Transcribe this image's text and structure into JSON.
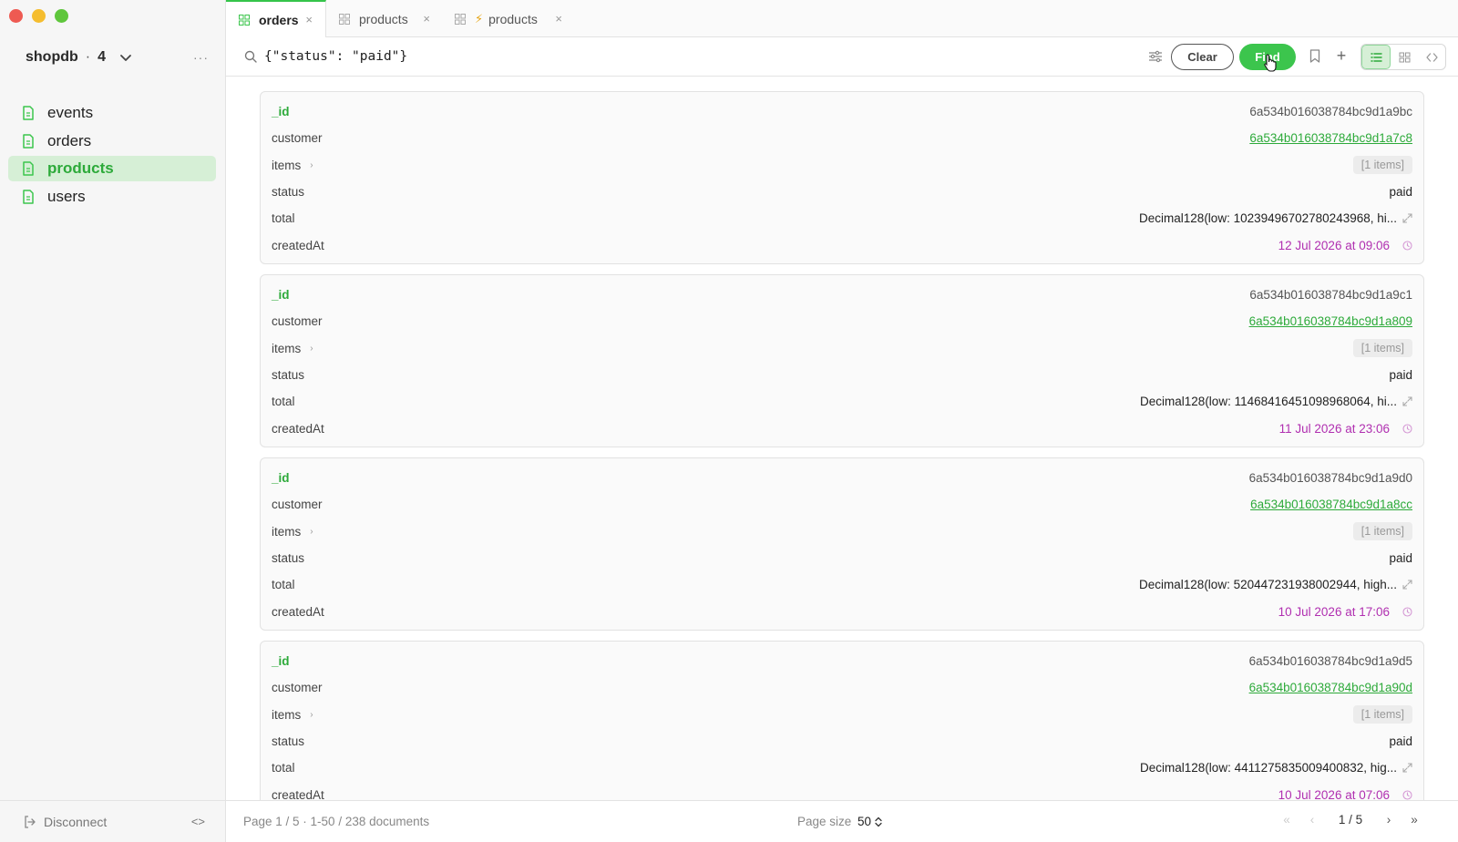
{
  "sidebar": {
    "db_name": "shopdb",
    "db_separator": "·",
    "db_count": "4",
    "more_label": "···",
    "collections": [
      {
        "label": "events",
        "active": false
      },
      {
        "label": "orders",
        "active": false
      },
      {
        "label": "products",
        "active": true
      },
      {
        "label": "users",
        "active": false
      }
    ],
    "disconnect_label": "Disconnect",
    "code_toggle": "<>"
  },
  "tabs": [
    {
      "label": "orders",
      "active": true,
      "bolt": false
    },
    {
      "label": "products",
      "active": false,
      "bolt": false
    },
    {
      "label": "products",
      "active": false,
      "bolt": true
    }
  ],
  "tab_close": "×",
  "query": {
    "value": "{\"status\": \"paid\"}",
    "clear_label": "Clear",
    "find_label": "Find",
    "plus_label": "+"
  },
  "documents": [
    {
      "id_key": "_id",
      "id": "6a534b016038784bc9d1a9bc",
      "customer_key": "customer",
      "customer": "6a534b016038784bc9d1a7c8",
      "items_key": "items",
      "items": "[1 items]",
      "status_key": "status",
      "status": "paid",
      "total_key": "total",
      "total": "Decimal128(low: 10239496702780243968, hi...",
      "created_key": "createdAt",
      "created": "12 Jul 2026 at 09:06"
    },
    {
      "id_key": "_id",
      "id": "6a534b016038784bc9d1a9c1",
      "customer_key": "customer",
      "customer": "6a534b016038784bc9d1a809",
      "items_key": "items",
      "items": "[1 items]",
      "status_key": "status",
      "status": "paid",
      "total_key": "total",
      "total": "Decimal128(low: 11468416451098968064, hi...",
      "created_key": "createdAt",
      "created": "11 Jul 2026 at 23:06"
    },
    {
      "id_key": "_id",
      "id": "6a534b016038784bc9d1a9d0",
      "customer_key": "customer",
      "customer": "6a534b016038784bc9d1a8cc",
      "items_key": "items",
      "items": "[1 items]",
      "status_key": "status",
      "status": "paid",
      "total_key": "total",
      "total": "Decimal128(low: 520447231938002944, high...",
      "created_key": "createdAt",
      "created": "10 Jul 2026 at 17:06"
    },
    {
      "id_key": "_id",
      "id": "6a534b016038784bc9d1a9d5",
      "customer_key": "customer",
      "customer": "6a534b016038784bc9d1a90d",
      "items_key": "items",
      "items": "[1 items]",
      "status_key": "status",
      "status": "paid",
      "total_key": "total",
      "total": "Decimal128(low: 4411275835009400832, hig...",
      "created_key": "createdAt",
      "created": "10 Jul 2026 at 07:06"
    }
  ],
  "footer": {
    "page_info": "Page 1 / 5  ·  1-50 / 238 documents",
    "page_size_label": "Page size",
    "page_size": "50",
    "nav_first": "«",
    "nav_prev": "‹",
    "page_indicator": "1 / 5",
    "nav_next": "›",
    "nav_last": "»"
  },
  "colors": {
    "accent": "#3cc54d",
    "accent_text": "#2daa3a",
    "active_bg": "#d6efd6",
    "date": "#b02fb0",
    "bolt": "#e6a516"
  }
}
